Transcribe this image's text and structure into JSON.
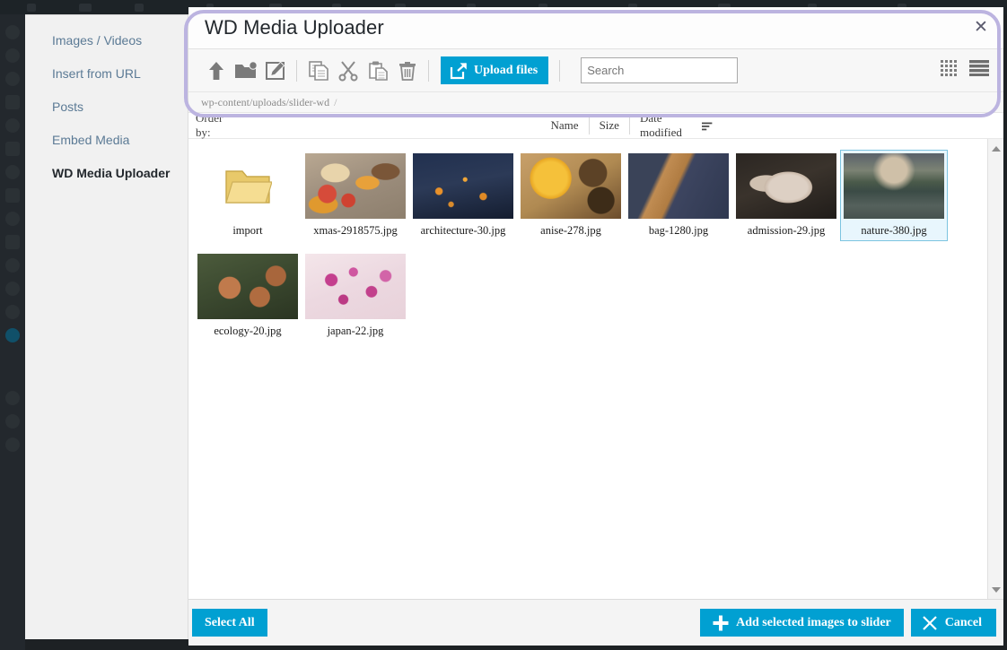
{
  "window": {
    "modal_title": "WD Media Uploader",
    "close_label": "✕"
  },
  "sidebar": {
    "items": [
      {
        "label": "Images / Videos",
        "active": false
      },
      {
        "label": "Insert from URL",
        "active": false
      },
      {
        "label": "Posts",
        "active": false
      },
      {
        "label": "Embed Media",
        "active": false
      },
      {
        "label": "WD Media Uploader",
        "active": true
      }
    ]
  },
  "toolbar": {
    "icons": [
      {
        "name": "up-level-icon",
        "title": "Up one level"
      },
      {
        "name": "new-folder-icon",
        "title": "New folder"
      },
      {
        "name": "rename-icon",
        "title": "Rename"
      },
      {
        "name": "copy-icon",
        "title": "Copy"
      },
      {
        "name": "cut-icon",
        "title": "Cut"
      },
      {
        "name": "paste-icon",
        "title": "Paste"
      },
      {
        "name": "trash-icon",
        "title": "Delete"
      }
    ],
    "upload_label": "Upload files",
    "upload_color": "#01a0d2",
    "search_value": "",
    "search_placeholder": "Search",
    "view_grid_icon": "grid-view-icon",
    "view_list_icon": "list-view-icon"
  },
  "breadcrumb": {
    "path": "wp-content/uploads/slider-wd",
    "separator": "/"
  },
  "order_bar": {
    "label": "Order by:",
    "options": [
      {
        "label": "Name",
        "sorted": false
      },
      {
        "label": "Size",
        "sorted": false
      },
      {
        "label": "Date modified",
        "sorted": true
      }
    ]
  },
  "files": [
    {
      "name": "import",
      "type": "folder",
      "thumb": "folder",
      "selected": false
    },
    {
      "name": "xmas-2918575.jpg",
      "type": "image",
      "thumb": "t-xmas",
      "selected": false
    },
    {
      "name": "architecture-30.jpg",
      "type": "image",
      "thumb": "t-arch",
      "selected": false
    },
    {
      "name": "anise-278.jpg",
      "type": "image",
      "thumb": "t-anise",
      "selected": false
    },
    {
      "name": "bag-1280.jpg",
      "type": "image",
      "thumb": "t-bag",
      "selected": false
    },
    {
      "name": "admission-29.jpg",
      "type": "image",
      "thumb": "t-adm",
      "selected": false
    },
    {
      "name": "nature-380.jpg",
      "type": "image",
      "thumb": "t-nature",
      "selected": true
    },
    {
      "name": "ecology-20.jpg",
      "type": "image",
      "thumb": "t-ecology",
      "selected": false
    },
    {
      "name": "japan-22.jpg",
      "type": "image",
      "thumb": "t-japan",
      "selected": false
    }
  ],
  "footer": {
    "select_all_label": "Select All",
    "add_label": "Add selected images to slider",
    "cancel_label": "Cancel",
    "button_color": "#01a0d2"
  },
  "annotation": {
    "color": "#bcb4e0"
  }
}
